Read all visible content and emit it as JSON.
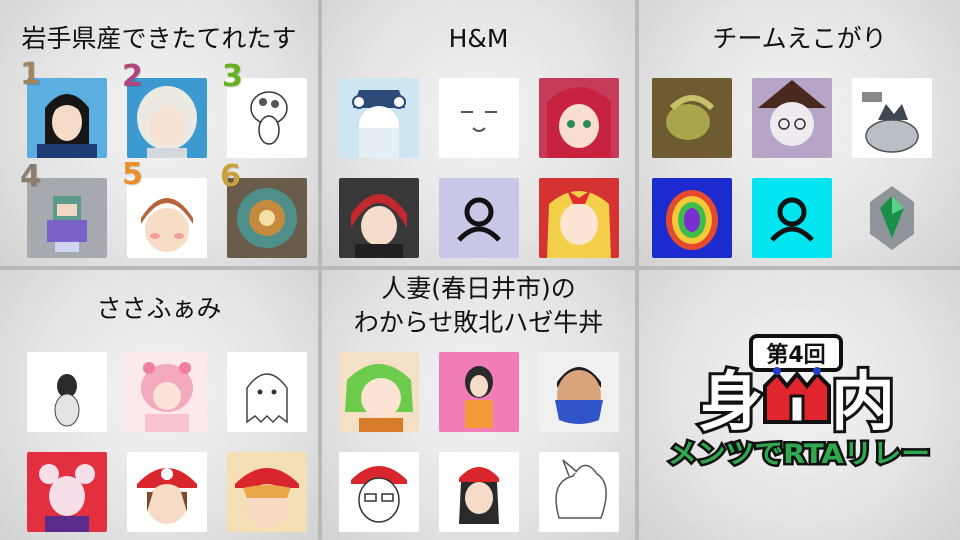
{
  "teams": [
    {
      "name": "岩手県産できたてれたす",
      "numbers": [
        "1",
        "2",
        "3",
        "4",
        "5",
        "6"
      ]
    },
    {
      "name": "H&M"
    },
    {
      "name": "チームえこがり"
    },
    {
      "name": "ささふぁみ"
    },
    {
      "name_line1": "人妻(春日井市)の",
      "name_line2": "わからせ敗北ハゼ牛丼"
    }
  ],
  "logo": {
    "edition": "第4回",
    "title_left": "身",
    "title_right": "内",
    "subtitle": "メンツでRTAリレー"
  },
  "colors": {
    "num1": "#a08562",
    "num2": "#b0477a",
    "num3": "#67b21f",
    "num4": "#8a7d70",
    "num5": "#e8902c",
    "num6": "#c9a13c",
    "logo_red": "#e0262c",
    "logo_blue": "#1f3fcc",
    "logo_pink": "#e8338f",
    "logo_green": "#2fa84f",
    "logo_orange": "#f08a00"
  }
}
